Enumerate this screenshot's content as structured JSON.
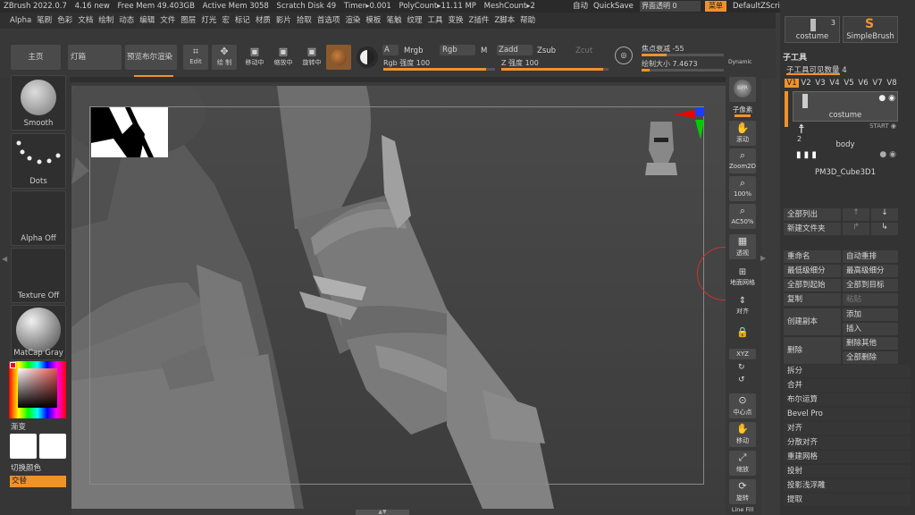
{
  "titlebar": {
    "app": "ZBrush 2022.0.7",
    "version": "4.16 new",
    "free_mem": "Free Mem 49.403GB",
    "active_mem": "Active Mem 3058",
    "scratch": "Scratch Disk 49",
    "timer": "Timer▸0.001",
    "polycount": "PolyCount▸11.11 MP",
    "meshcount": "MeshCount▸2",
    "auto": "自动",
    "quicksave": "QuickSave",
    "transparency": "界面透明 0",
    "menu": "菜单",
    "script": "DefaultZScript"
  },
  "menu": [
    "Alpha",
    "笔刷",
    "色彩",
    "文档",
    "绘制",
    "动态",
    "编辑",
    "文件",
    "图层",
    "灯光",
    "宏",
    "标记",
    "材质",
    "影片",
    "拾取",
    "首选项",
    "渲染",
    "模板",
    "笔触",
    "纹理",
    "工具",
    "变换",
    "Z插件",
    "Z脚本",
    "帮助"
  ],
  "toolbar": {
    "home": "主页",
    "lightbox": "灯箱",
    "preview": "预览布尔渲染",
    "edit": "Edit",
    "draw": "绘 制",
    "move": "移动中",
    "scale": "缩放中",
    "rotate": "旋转中",
    "a": "A",
    "mrgb": "Mrgb",
    "rgb": "Rgb",
    "m": "M",
    "zadd": "Zadd",
    "zsub": "Zsub",
    "zcut": "Zcut",
    "rgb_intensity": "Rgb 强度 100",
    "z_intensity": "Z 强度 100",
    "focal": "焦点衰减 -55",
    "draw_size": "绘制大小 7.4673",
    "dynamic": "Dynamic"
  },
  "left": {
    "smooth": "Smooth",
    "dots": "Dots",
    "alpha_off": "Alpha Off",
    "texture_off": "Texture Off",
    "matcap": "MatCap Gray",
    "gradient": "渐变",
    "switch_color": "切换颜色",
    "alternate": "交替"
  },
  "rightbar": {
    "bpr": "BPR",
    "subpixel": "子像素",
    "scroll": "滚动",
    "zoom2d": "Zoom2D",
    "p100": "100%",
    "ac50": "AC50%",
    "perspective": "透视",
    "floor": "地面网格",
    "frame": "对齐",
    "xyz": "XYZ",
    "center": "中心点",
    "move": "移动",
    "scale": "缩放",
    "rotate": "旋转",
    "linefill": "Line Fill"
  },
  "rpanel": {
    "costume_label": "costume",
    "costume_count": "3",
    "simplebrush": "SimpleBrush",
    "subtool_title": "子工具",
    "visible_count": "子工具可见数量 4",
    "versions": [
      "V1",
      "V2",
      "V3",
      "V4",
      "V5",
      "V6",
      "V7",
      "V8"
    ],
    "subtools": [
      "costume",
      "body",
      "PM3D_Cube3D1"
    ],
    "body_num": "2",
    "list_all": "全部列出",
    "new_folder": "新建文件夹",
    "rename": "重命名",
    "auto_reorder": "自动重排",
    "lowest_sub": "最低级细分",
    "highest_sub": "最高级细分",
    "all_to_start": "全部到起始",
    "all_to_target": "全部到目标",
    "copy": "复制",
    "paste": "粘贴",
    "create_copy": "创建副本",
    "add": "添加",
    "insert": "插入",
    "delete": "删除",
    "delete_others": "删除其他",
    "delete_all": "全部删除",
    "split": "拆分",
    "merge": "合并",
    "boolean": "布尔运算",
    "bevel": "Bevel Pro",
    "align": "对齐",
    "distribute": "分散对齐",
    "remesh": "重建网格",
    "project": "投射",
    "project_shallow": "投影浅浮雕",
    "extract": "提取"
  },
  "colors": {
    "accent": "#f0922b",
    "panel": "#333333",
    "viewport": "#4a4a4a"
  }
}
